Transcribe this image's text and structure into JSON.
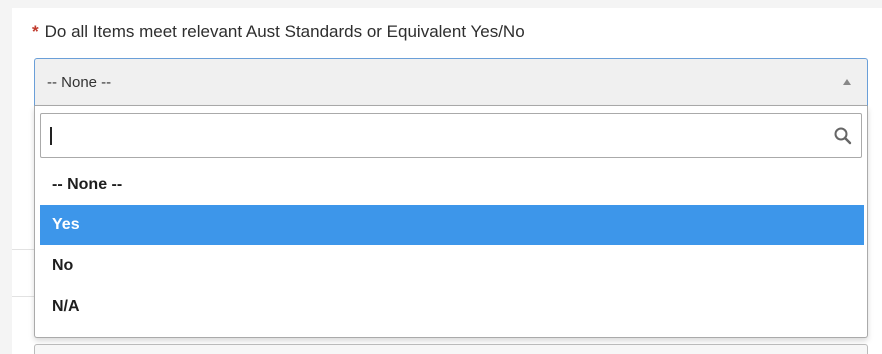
{
  "field": {
    "required_marker": "*",
    "label": "Do all Items meet relevant Aust Standards or Equivalent Yes/No",
    "selected_value": "-- None --"
  },
  "dropdown": {
    "search": {
      "value": "",
      "placeholder": "",
      "icon": "search-icon"
    },
    "options": [
      {
        "label": "-- None --",
        "highlighted": false
      },
      {
        "label": "Yes",
        "highlighted": true
      },
      {
        "label": "No",
        "highlighted": false
      },
      {
        "label": "N/A",
        "highlighted": false
      }
    ]
  },
  "colors": {
    "highlight": "#3d96ea",
    "required": "#c0392b",
    "focus_border": "#6a9fd8"
  }
}
